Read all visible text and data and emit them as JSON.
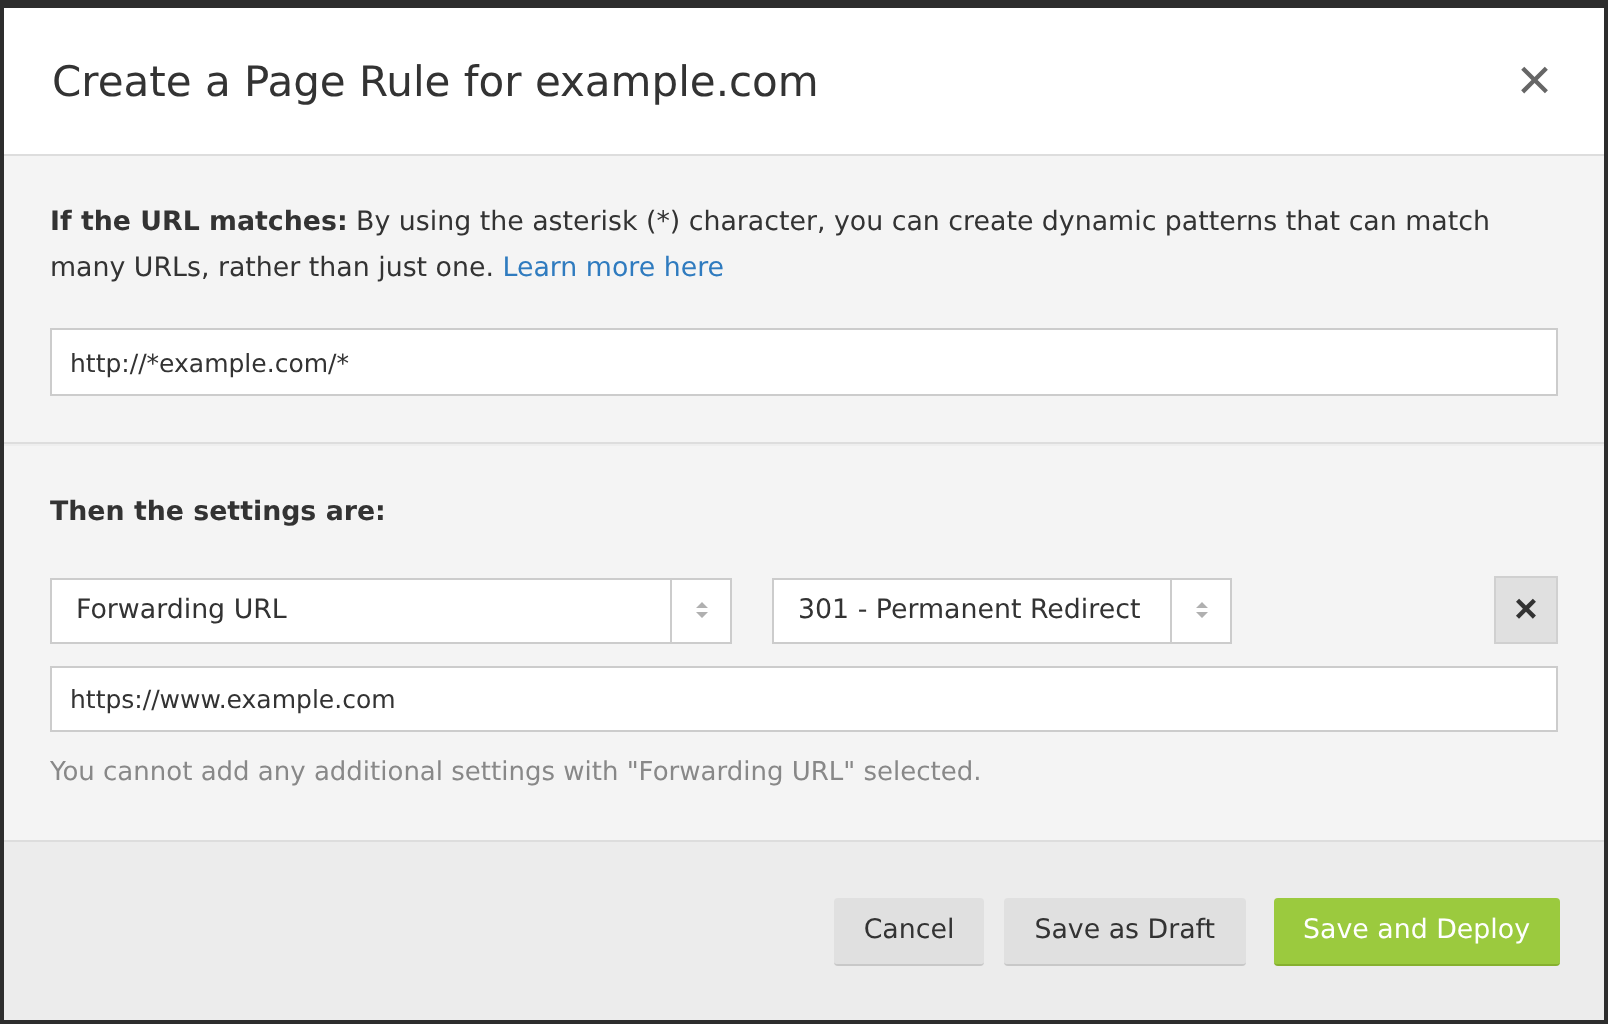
{
  "dialog": {
    "title": "Create a Page Rule for example.com",
    "close": "×"
  },
  "url_section": {
    "intro_bold": "If the URL matches:",
    "intro": "By using the asterisk (*) character, you can create dynamic patterns that can match many URLs, rather than just one.",
    "link": "Learn more here",
    "url_value": "http://*example.com/*"
  },
  "settings_section": {
    "heading": "Then the settings are:",
    "setting": "Forwarding URL",
    "status_code": "301 - Permanent Redirect",
    "remove": "×",
    "destination_value": "https://www.example.com",
    "note": "You cannot add any additional settings with \"Forwarding URL\" selected."
  },
  "buttons": [
    {
      "label": "Cancel",
      "kind": "secondary"
    },
    {
      "label": "Save as Draft",
      "kind": "secondary"
    },
    {
      "label": "Save and Deploy",
      "kind": "primary"
    }
  ]
}
